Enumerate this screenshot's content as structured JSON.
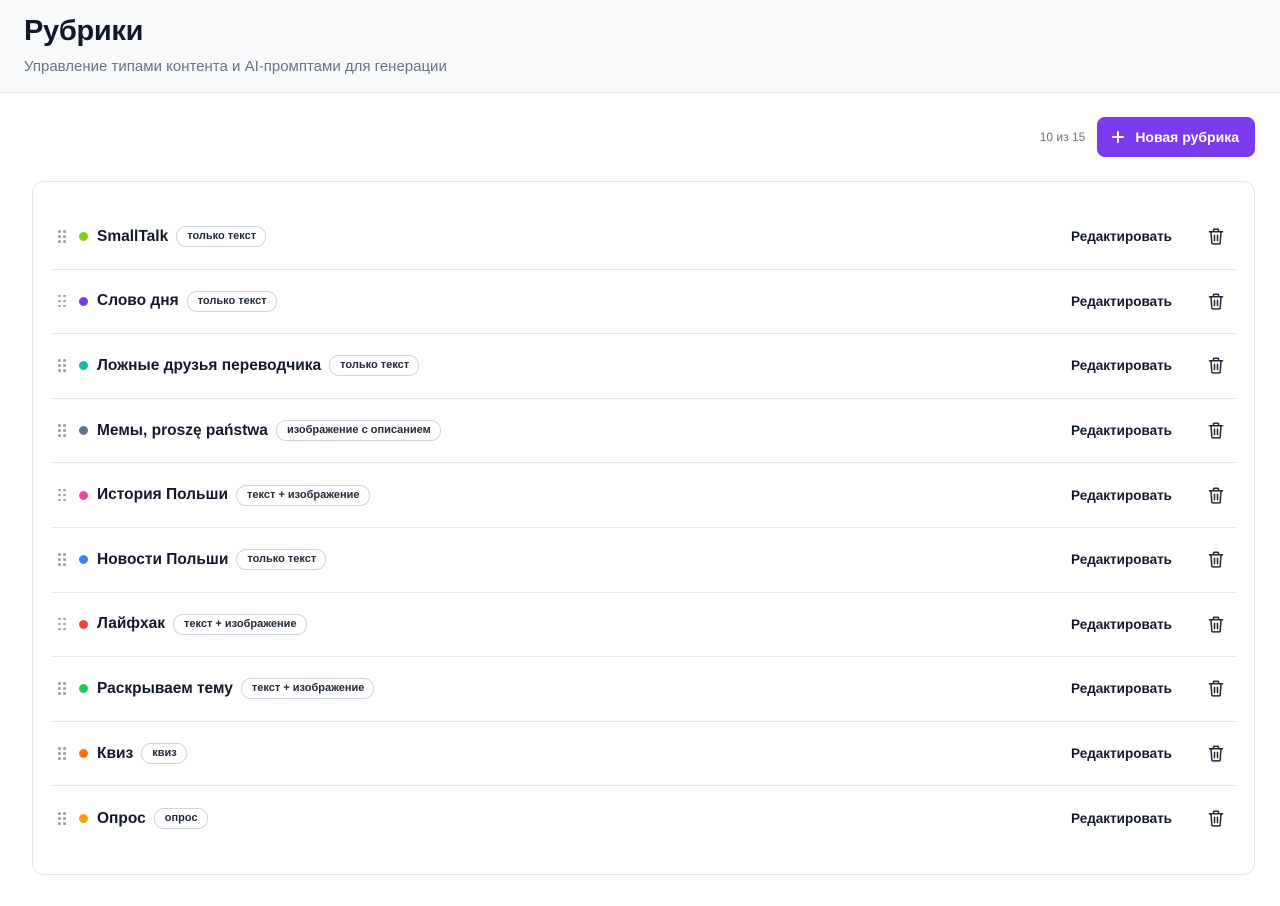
{
  "header": {
    "title": "Рубрики",
    "subtitle": "Управление типами контента и AI-промптами для генерации"
  },
  "toolbar": {
    "counter": "10 из 15",
    "new_button_label": "Новая рубрика"
  },
  "rubrics": [
    {
      "name": "SmallTalk",
      "badge": "только текст",
      "color": "#84cc16",
      "edit_label": "Редактировать"
    },
    {
      "name": "Слово дня",
      "badge": "только текст",
      "color": "#7c3aed",
      "edit_label": "Редактировать"
    },
    {
      "name": "Ложные друзья переводчика",
      "badge": "только текст",
      "color": "#14b8a6",
      "edit_label": "Редактировать"
    },
    {
      "name": "Мемы, proszę państwa",
      "badge": "изображение с описанием",
      "color": "#64748b",
      "edit_label": "Редактировать"
    },
    {
      "name": "История Польши",
      "badge": "текст + изображение",
      "color": "#ec4899",
      "edit_label": "Редактировать"
    },
    {
      "name": "Новости Польши",
      "badge": "только текст",
      "color": "#3b82f6",
      "edit_label": "Редактировать"
    },
    {
      "name": "Лайфхак",
      "badge": "текст + изображение",
      "color": "#ef4444",
      "edit_label": "Редактировать"
    },
    {
      "name": "Раскрываем тему",
      "badge": "текст + изображение",
      "color": "#22c55e",
      "edit_label": "Редактировать"
    },
    {
      "name": "Квиз",
      "badge": "квиз",
      "color": "#f97316",
      "edit_label": "Редактировать"
    },
    {
      "name": "Опрос",
      "badge": "опрос",
      "color": "#f59e0b",
      "edit_label": "Редактировать"
    }
  ],
  "icons": {
    "drag": "drag-handle-icon",
    "delete": "trash-icon",
    "add": "plus-icon"
  }
}
